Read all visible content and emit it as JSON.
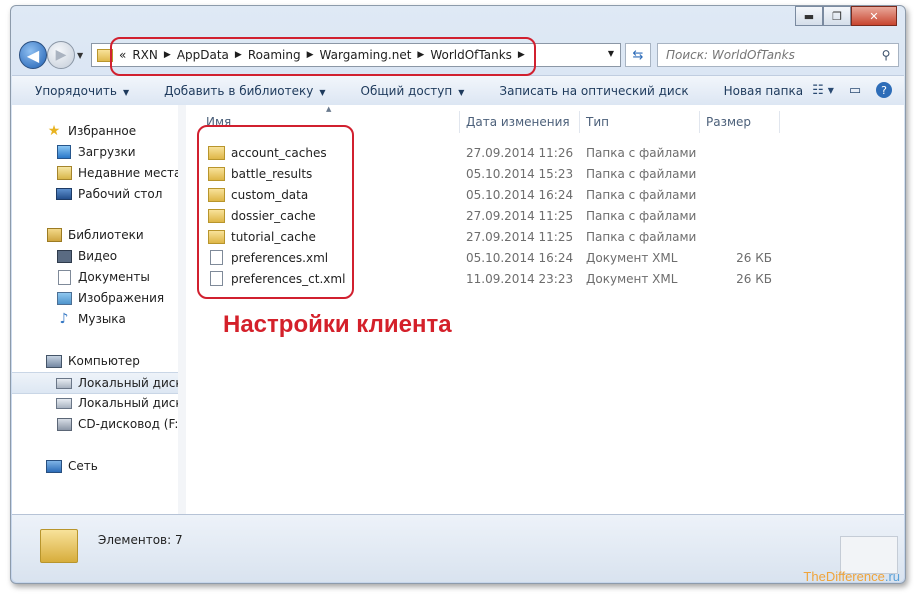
{
  "window": {
    "minimize": "▬",
    "maximize": "❐",
    "close": "✕"
  },
  "nav": {
    "back": "◀",
    "forward": "▶",
    "breadcrumb": [
      {
        "label": "«"
      },
      {
        "label": "RXN"
      },
      {
        "label": "AppData"
      },
      {
        "label": "Roaming"
      },
      {
        "label": "Wargaming.net"
      },
      {
        "label": "WorldOfTanks"
      }
    ],
    "crumb_sep": "▶",
    "search_placeholder": "Поиск: WorldOfTanks"
  },
  "toolbar": {
    "organize": "Упорядочить",
    "add_library": "Добавить в библиотеку",
    "share": "Общий доступ",
    "burn": "Записать на оптический диск",
    "new_folder": "Новая папка"
  },
  "sidebar": {
    "items": [
      {
        "label": "Избранное",
        "icon": "star-icon"
      },
      {
        "label": "Загрузки",
        "icon": "downloads-icon"
      },
      {
        "label": "Недавние места",
        "icon": "recent-places-icon"
      },
      {
        "label": "Рабочий стол",
        "icon": "desktop-icon"
      },
      {
        "label": "Библиотеки",
        "icon": "library-icon"
      },
      {
        "label": "Видео",
        "icon": "video-icon"
      },
      {
        "label": "Документы",
        "icon": "documents-icon"
      },
      {
        "label": "Изображения",
        "icon": "pictures-icon"
      },
      {
        "label": "Музыка",
        "icon": "music-icon"
      },
      {
        "label": "Компьютер",
        "icon": "computer-icon"
      },
      {
        "label": "Локальный диск (C",
        "icon": "drive-icon"
      },
      {
        "label": "Локальный диск (D",
        "icon": "drive-icon"
      },
      {
        "label": "CD-дисковод (F:) HU",
        "icon": "cd-drive-icon"
      },
      {
        "label": "Сеть",
        "icon": "network-icon"
      }
    ]
  },
  "columns": {
    "name": "Имя",
    "date": "Дата изменения",
    "type": "Тип",
    "size": "Размер"
  },
  "files": [
    {
      "name": "account_caches",
      "date": "27.09.2014 11:26",
      "type": "Папка с файлами",
      "size": "",
      "kind": "folder"
    },
    {
      "name": "battle_results",
      "date": "05.10.2014 15:23",
      "type": "Папка с файлами",
      "size": "",
      "kind": "folder"
    },
    {
      "name": "custom_data",
      "date": "05.10.2014 16:24",
      "type": "Папка с файлами",
      "size": "",
      "kind": "folder"
    },
    {
      "name": "dossier_cache",
      "date": "27.09.2014 11:25",
      "type": "Папка с файлами",
      "size": "",
      "kind": "folder"
    },
    {
      "name": "tutorial_cache",
      "date": "27.09.2014 11:25",
      "type": "Папка с файлами",
      "size": "",
      "kind": "folder"
    },
    {
      "name": "preferences.xml",
      "date": "05.10.2014 16:24",
      "type": "Документ XML",
      "size": "26 КБ",
      "kind": "xml"
    },
    {
      "name": "preferences_ct.xml",
      "date": "11.09.2014 23:23",
      "type": "Документ XML",
      "size": "26 КБ",
      "kind": "xml"
    }
  ],
  "annotation": "Настройки клиента",
  "status": {
    "count": "Элементов: 7"
  },
  "watermark": {
    "part1": "The",
    "part2": "Difference",
    "part3": ".ru"
  },
  "colors": {
    "callout": "#d1202f",
    "annotation": "#d4202a"
  }
}
